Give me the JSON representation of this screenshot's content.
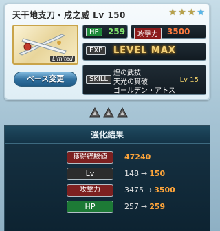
{
  "weapon": {
    "title": "天干地支刀・戌之威 Lv 150",
    "badge": "Limited",
    "stars": [
      {
        "icon": "gold-star-icon",
        "color": "#b8a24a"
      },
      {
        "icon": "gold-star-icon",
        "color": "#b8a24a"
      },
      {
        "icon": "gold-star-icon",
        "color": "#b8a24a"
      },
      {
        "icon": "blue-star-icon",
        "color": "#58b7ea"
      }
    ]
  },
  "stats": {
    "hp_label": "HP",
    "hp_value": "259",
    "atk_label": "攻撃力",
    "atk_value": "3500",
    "exp_label": "EXP",
    "exp_value": "LEVEL MAX"
  },
  "buttons": {
    "base_change": "ベース変更"
  },
  "skill": {
    "label": "SKILL",
    "lines": [
      "煌の武技",
      "天光の貫破",
      "ゴールデン・アトス"
    ],
    "level": "Lv 15"
  },
  "results": {
    "title": "強化結果",
    "rows": [
      {
        "label": "獲得経験値",
        "value": "47240"
      },
      {
        "label": "Lv",
        "old": "148",
        "arrow": "→",
        "new": "150"
      },
      {
        "label": "攻撃力",
        "old": "3475",
        "arrow": "→",
        "new": "3500"
      },
      {
        "label": "HP",
        "old": "257",
        "arrow": "→",
        "new": "259"
      }
    ]
  }
}
